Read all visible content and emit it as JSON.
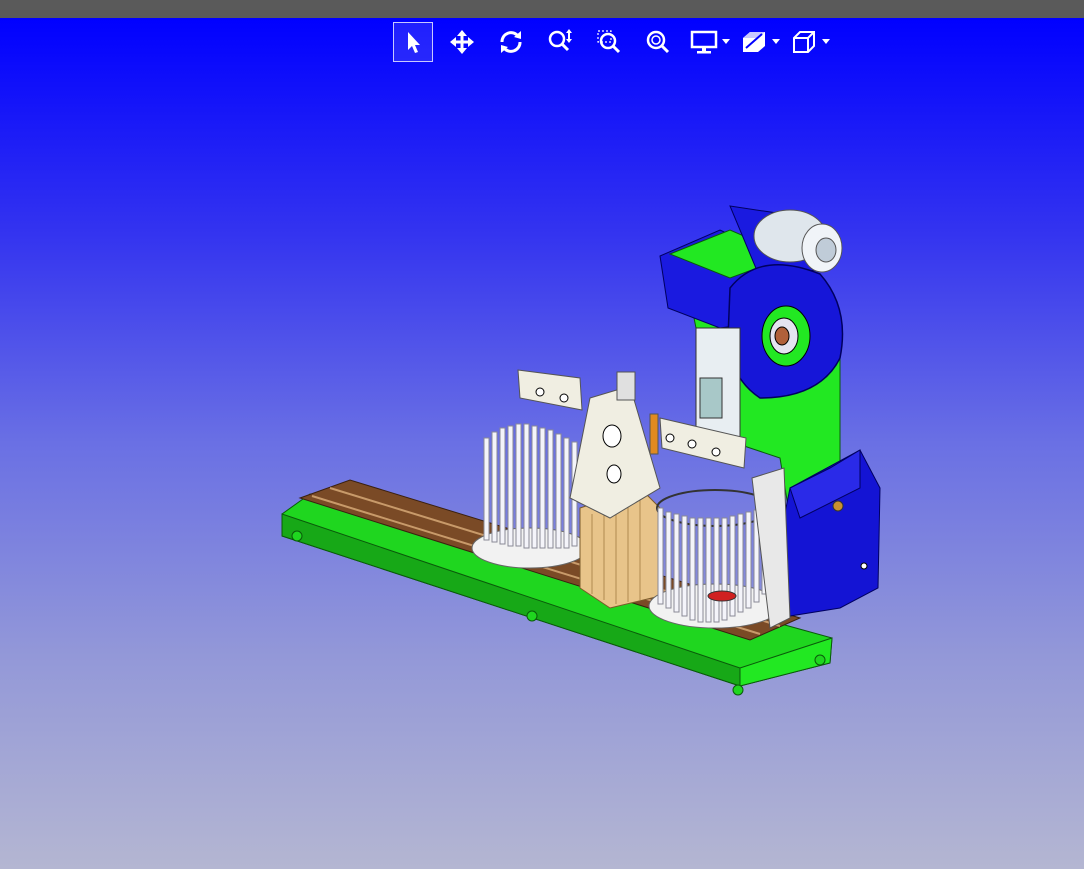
{
  "viewer": {
    "background_top": "#0000ff",
    "background_bottom": "#b4b6d2"
  },
  "toolbar": {
    "tools": [
      {
        "id": "select",
        "icon": "select-arrow-icon",
        "active": true
      },
      {
        "id": "pan",
        "icon": "pan-move-icon",
        "active": false
      },
      {
        "id": "rotate",
        "icon": "rotate-icon",
        "active": false
      },
      {
        "id": "zoom",
        "icon": "zoom-icon",
        "active": false
      },
      {
        "id": "zoom-window",
        "icon": "zoom-window-icon",
        "active": false
      },
      {
        "id": "zoom-fit",
        "icon": "zoom-fit-icon",
        "active": false
      }
    ],
    "dropdowns": [
      {
        "id": "display-mode",
        "icon": "monitor-icon"
      },
      {
        "id": "section-view",
        "icon": "section-view-icon"
      },
      {
        "id": "standard-views",
        "icon": "cube-view-icon"
      }
    ]
  },
  "model": {
    "icon": "cad-machine-model",
    "colors": {
      "base_frame": "#22e822",
      "rail": "#7a4a26",
      "press_body": "#1010d0",
      "press_column": "#22e822",
      "flywheel": "#1818e0",
      "motor": "#d8e0e8",
      "bracket": "#f0eee2",
      "block": "#e8c48a",
      "rods": "#e8e8ee"
    }
  }
}
